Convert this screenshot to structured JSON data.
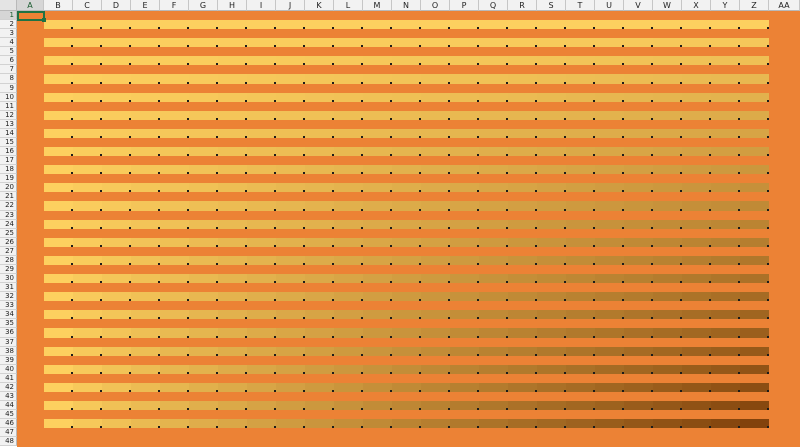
{
  "sheet": {
    "columns": [
      "A",
      "B",
      "C",
      "D",
      "E",
      "F",
      "G",
      "H",
      "I",
      "J",
      "K",
      "L",
      "M",
      "N",
      "O",
      "P",
      "Q",
      "R",
      "S",
      "T",
      "U",
      "V",
      "W",
      "X",
      "Y",
      "Z",
      "AA"
    ],
    "rows": [
      "1",
      "2",
      "3",
      "4",
      "5",
      "6",
      "7",
      "8",
      "9",
      "10",
      "11",
      "12",
      "13",
      "14",
      "15",
      "16",
      "17",
      "18",
      "19",
      "20",
      "21",
      "22",
      "23",
      "24",
      "25",
      "26",
      "27",
      "28",
      "29",
      "30",
      "31",
      "32",
      "33",
      "34",
      "35",
      "36",
      "37",
      "38",
      "39",
      "40",
      "41",
      "42",
      "43",
      "44",
      "45",
      "46",
      "47",
      "48"
    ],
    "active_cell": "A1",
    "colors": {
      "background_orange": "#ec8235",
      "light_cell": "#fdd05f",
      "darkest_cell": "#7f3f0a",
      "selection_border": "#1f7244",
      "header_bg": "#f2f2f2",
      "selected_header_bg": "#d6d6d6"
    }
  }
}
